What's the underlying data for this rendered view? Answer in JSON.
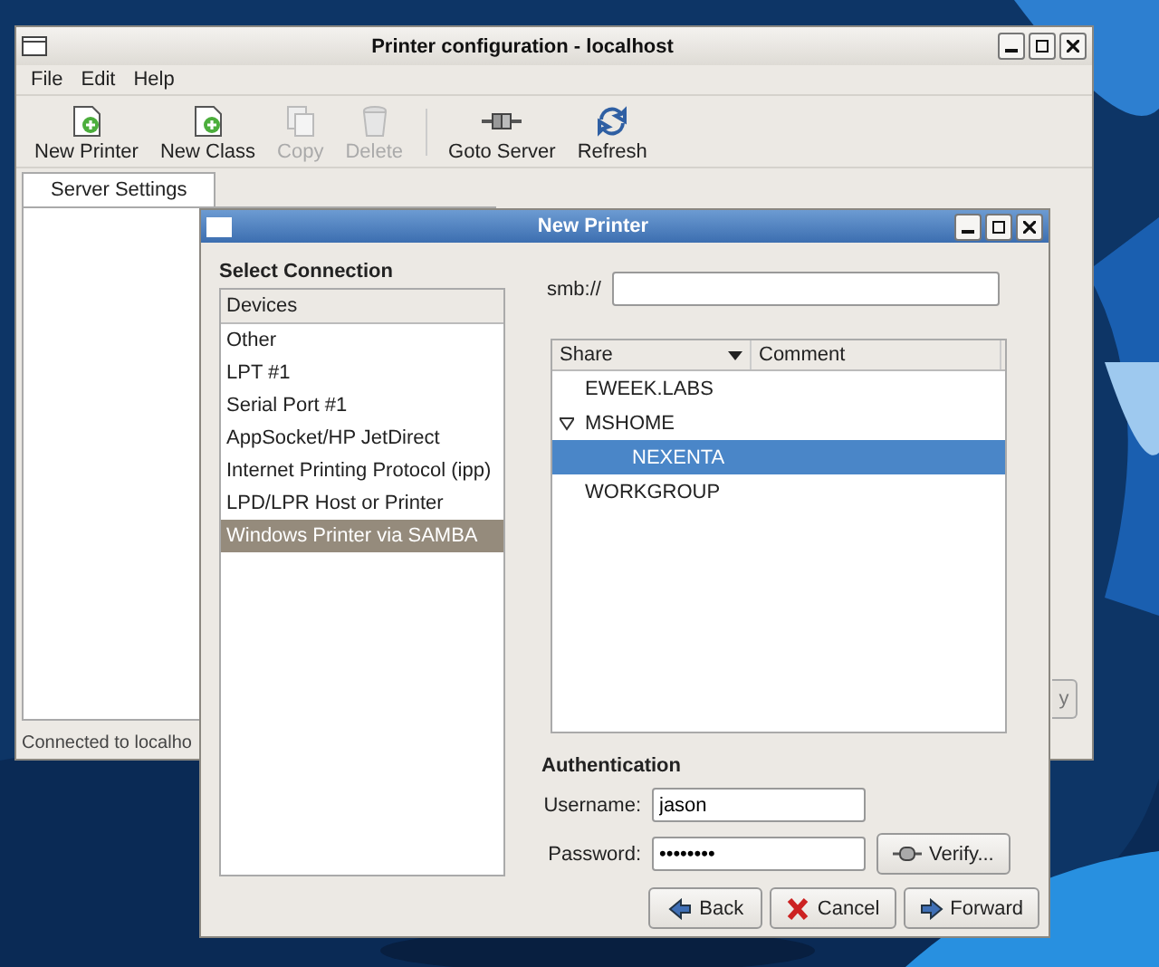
{
  "main_window": {
    "title": "Printer configuration - localhost",
    "menu": [
      {
        "label": "File"
      },
      {
        "label": "Edit"
      },
      {
        "label": "Help"
      }
    ],
    "toolbar": [
      {
        "label": "New Printer",
        "kind": "new",
        "disabled": false
      },
      {
        "label": "New Class",
        "kind": "new",
        "disabled": false
      },
      {
        "label": "Copy",
        "kind": "copy",
        "disabled": true
      },
      {
        "label": "Delete",
        "kind": "delete",
        "disabled": true
      },
      {
        "label": "Goto Server",
        "kind": "connect",
        "disabled": false
      },
      {
        "label": "Refresh",
        "kind": "refresh",
        "disabled": false
      }
    ],
    "tabs": [
      {
        "label": "Server Settings",
        "selected": true
      }
    ],
    "partial_button": "y",
    "status_bar": "Connected to localho"
  },
  "dialog": {
    "title": "New Printer",
    "section": "Select Connection",
    "devices": {
      "header": "Devices",
      "items": [
        {
          "label": "Other",
          "selected": false
        },
        {
          "label": "LPT #1",
          "selected": false
        },
        {
          "label": "Serial Port #1",
          "selected": false
        },
        {
          "label": "AppSocket/HP JetDirect",
          "selected": false
        },
        {
          "label": "Internet Printing Protocol (ipp)",
          "selected": false
        },
        {
          "label": "LPD/LPR Host or Printer",
          "selected": false
        },
        {
          "label": "Windows Printer via SAMBA",
          "selected": true
        }
      ]
    },
    "smb": {
      "label": "smb://"
    },
    "tree": {
      "columns": [
        {
          "label": "Share",
          "sorted": true
        },
        {
          "label": "Comment",
          "sorted": false
        }
      ],
      "rows": [
        {
          "label": "EWEEK.LABS",
          "selected": false
        },
        {
          "label": "MSHOME",
          "selected": false,
          "expanded": true,
          "children": [
            {
              "label": "NEXENTA",
              "selected": true
            }
          ]
        },
        {
          "label": "WORKGROUP",
          "selected": false
        }
      ]
    },
    "authentication": {
      "heading": "Authentication",
      "username": {
        "label": "Username:",
        "value": "jason"
      },
      "password": {
        "label": "Password:",
        "value": "••••••••"
      },
      "verify": "Verify..."
    },
    "buttons": [
      {
        "label": "Back",
        "kind": "back"
      },
      {
        "label": "Cancel",
        "kind": "cancel"
      },
      {
        "label": "Forward",
        "kind": "forward"
      }
    ]
  }
}
